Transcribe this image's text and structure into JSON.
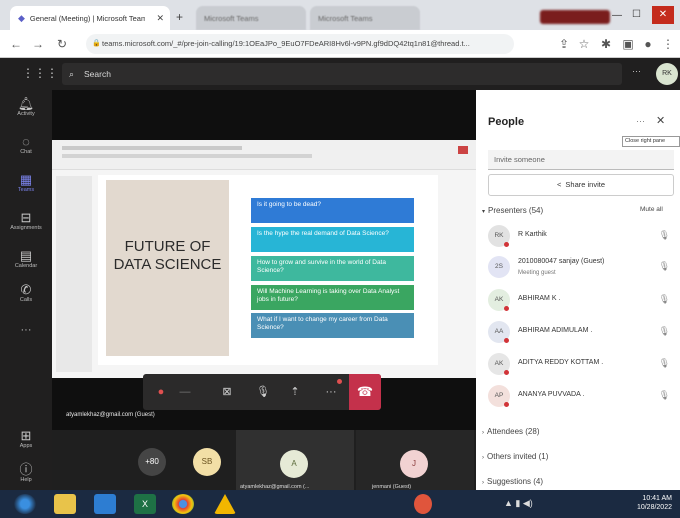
{
  "browser": {
    "tabs": [
      {
        "label": "General (Meeting) | Microsoft Teams"
      },
      {
        "label": "Microsoft Teams"
      },
      {
        "label": "Microsoft Teams"
      }
    ],
    "url": "teams.microsoft.com/_#/pre-join-calling/19:1OEaJPo_9EuO7FDeARI8Hv6l-v9PN.gf9dDQ42tq1n81@thread.t..."
  },
  "teams": {
    "search_placeholder": "Search",
    "user_initials": "RK",
    "more": "···"
  },
  "rail": [
    {
      "label": "Activity",
      "icon": "bell-icon"
    },
    {
      "label": "Chat",
      "icon": "chat-icon"
    },
    {
      "label": "Teams",
      "icon": "teams-icon"
    },
    {
      "label": "Assignments",
      "icon": "assignments-icon"
    },
    {
      "label": "Calendar",
      "icon": "calendar-icon"
    },
    {
      "label": "Calls",
      "icon": "phone-icon"
    },
    {
      "label": "···",
      "icon": "more-icon"
    },
    {
      "label": "Apps",
      "icon": "apps-icon"
    },
    {
      "label": "Help",
      "icon": "help-icon"
    }
  ],
  "slide": {
    "title": "FUTURE OF DATA SCIENCE",
    "questions": [
      "Is it going to be dead?",
      "Is the hype the real demand of Data Science?",
      "How to grow and survive in the world of Data Science?",
      "Will Machine Learning is taking over Data Analyst jobs in future?",
      "What if I want to change my career from Data Science?"
    ],
    "colors": [
      "#2f7bd6",
      "#27b5d6",
      "#3eb89e",
      "#3aa661",
      "#4a8fb5"
    ]
  },
  "presenter_email": "atyamlekhaz@gmail.com (Guest)",
  "participants": {
    "overflow": "+80",
    "tiles": [
      {
        "initials": "SB"
      },
      {
        "initials": "A",
        "caption": "atyamlekhaz@gmail.com (..."
      },
      {
        "initials": "J",
        "caption": "jenmani (Guest)"
      }
    ]
  },
  "people_panel": {
    "title": "People",
    "tooltip": "Close right pane",
    "invite_placeholder": "Invite someone",
    "share_invite": "Share invite",
    "presenters_label": "Presenters (54)",
    "mute_all": "Mute all",
    "presenters": [
      {
        "initials": "RK",
        "name": "R Karthik",
        "sub": ""
      },
      {
        "initials": "2S",
        "name": "2010080047 sanjay (Guest)",
        "sub": "Meeting guest"
      },
      {
        "initials": "AK",
        "name": "ABHIRAM K .",
        "sub": ""
      },
      {
        "initials": "AA",
        "name": "ABHIRAM ADIMULAM .",
        "sub": ""
      },
      {
        "initials": "AK",
        "name": "ADITYA REDDY KOTTAM .",
        "sub": ""
      },
      {
        "initials": "AP",
        "name": "ANANYA PUVVADA .",
        "sub": ""
      }
    ],
    "attendees_label": "Attendees (28)",
    "others_label": "Others invited (1)",
    "suggestions_label": "Suggestions (4)"
  },
  "taskbar": {
    "time": "10:41 AM",
    "date": "10/28/2022"
  }
}
